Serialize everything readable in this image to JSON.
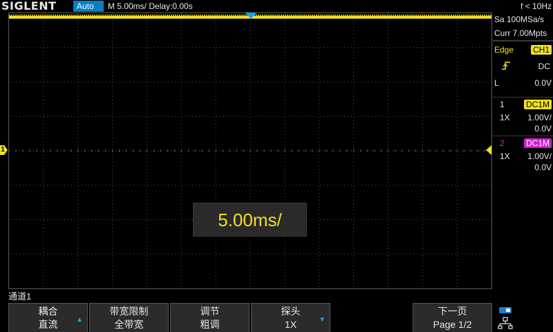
{
  "topbar": {
    "logo": "SIGLENT",
    "mode": "Auto",
    "timebase_info": "M 5.00ms/ Delay:0.00s",
    "frequency": "f < 10Hz"
  },
  "popup": {
    "timebase": "5.00ms/"
  },
  "markers": {
    "ch1_ground": "1"
  },
  "acquisition": {
    "sample_rate": "Sa 100MSa/s",
    "memory_depth": "Curr 7.00Mpts"
  },
  "trigger": {
    "type": "Edge",
    "source": "CH1",
    "slope_icon": "rising-edge-icon",
    "coupling": "DC",
    "level_label": "L",
    "level_value": "0.0V"
  },
  "channels": [
    {
      "number": "1",
      "coupling": "DC1M",
      "probe": "1X",
      "scale": "1.00V/",
      "offset": "0.0V",
      "color": "#f0e020"
    },
    {
      "number": "2",
      "coupling": "DC1M",
      "probe": "1X",
      "scale": "1.00V/",
      "offset": "0.0V",
      "color": "#d020d0"
    }
  ],
  "menu": {
    "title": "通道1",
    "softkeys": [
      {
        "line1": "耦合",
        "line2": "直流",
        "has_arrow": true,
        "arrow": "▲"
      },
      {
        "line1": "带宽限制",
        "line2": "全带宽",
        "has_arrow": false
      },
      {
        "line1": "调节",
        "line2": "粗调",
        "has_arrow": false
      },
      {
        "line1": "探头",
        "line2": "1X",
        "has_arrow": true,
        "arrow": "▼"
      },
      {
        "line1": "",
        "line2": "",
        "has_arrow": false
      },
      {
        "line1": "下一页",
        "line2": "Page 1/2",
        "has_arrow": false
      }
    ],
    "status_icon": "network-icon"
  },
  "colors": {
    "ch1": "#f0e020",
    "ch2": "#d020d0",
    "accent": "#18a4e8",
    "mode_badge": "#0a7fc4"
  }
}
